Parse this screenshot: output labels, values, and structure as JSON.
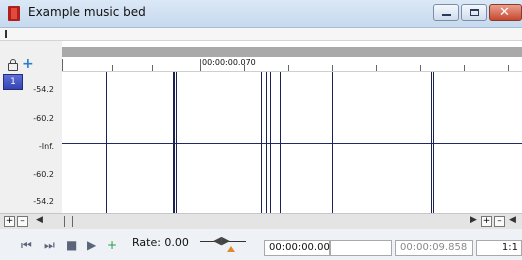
{
  "window": {
    "title": "Example music bed",
    "close_glyph": "✕"
  },
  "track": {
    "number": "1",
    "db_labels": [
      "-54.2",
      "-60.2",
      "-Inf.",
      "-60.2",
      "-54.2"
    ]
  },
  "ruler": {
    "time_label": "00:00:00.070"
  },
  "scroll": {
    "zoom_in": "+",
    "zoom_out": "–",
    "left_arrow": "◀",
    "right_arrow": "▶"
  },
  "transport": {
    "rate_label": "Rate: 0.00",
    "position_value": "00:00:00.000",
    "end_value": "00:00:09.858",
    "ratio_value": "1:1"
  },
  "icons": {
    "lock": "lock-icon",
    "snap": "snap-icon",
    "go_start": "go-to-start-icon",
    "go_end": "go-to-end-icon",
    "stop": "stop-icon",
    "play": "play-icon",
    "loop": "loop-play-icon"
  }
}
